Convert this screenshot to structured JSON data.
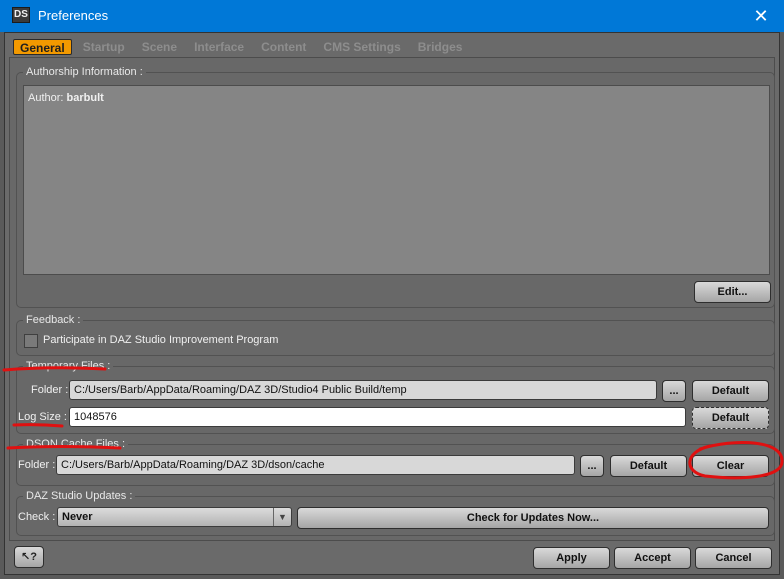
{
  "window": {
    "app_icon": "DS",
    "title": "Preferences",
    "close_glyph": "✕"
  },
  "tabs": [
    {
      "label": "General",
      "active": true
    },
    {
      "label": "Startup",
      "active": false
    },
    {
      "label": "Scene",
      "active": false
    },
    {
      "label": "Interface",
      "active": false
    },
    {
      "label": "Content",
      "active": false
    },
    {
      "label": "CMS Settings",
      "active": false
    },
    {
      "label": "Bridges",
      "active": false
    }
  ],
  "authorship": {
    "legend": "Authorship Information :",
    "author_prefix": "Author:",
    "author_name": "barbult",
    "edit_label": "Edit..."
  },
  "feedback": {
    "legend": "Feedback :",
    "checkbox_label": "Participate in DAZ Studio Improvement Program",
    "checked": false
  },
  "temporary_files": {
    "legend": "Temporary Files :",
    "folder_label": "Folder :",
    "folder_value": "C:/Users/Barb/AppData/Roaming/DAZ 3D/Studio4 Public Build/temp",
    "browse_label": "...",
    "default_label": "Default",
    "log_size_label": "Log Size :",
    "log_size_value": "1048576",
    "log_default_label": "Default"
  },
  "dson_cache": {
    "legend": "DSON Cache Files :",
    "folder_label": "Folder :",
    "folder_value": "C:/Users/Barb/AppData/Roaming/DAZ 3D/dson/cache",
    "browse_label": "...",
    "default_label": "Default",
    "clear_label": "Clear"
  },
  "updates": {
    "legend": "DAZ Studio Updates :",
    "check_label": "Check :",
    "check_value": "Never",
    "check_now_label": "Check for Updates Now..."
  },
  "footer": {
    "help_glyph": "↖?",
    "apply_label": "Apply",
    "accept_label": "Accept",
    "cancel_label": "Cancel"
  },
  "colors": {
    "titlebar": "#0078d7",
    "active_tab": "#f29900",
    "annotation_red": "#e01010"
  },
  "icons": [
    "app-logo-icon",
    "close-icon",
    "chevron-down-icon",
    "help-cursor-icon"
  ]
}
